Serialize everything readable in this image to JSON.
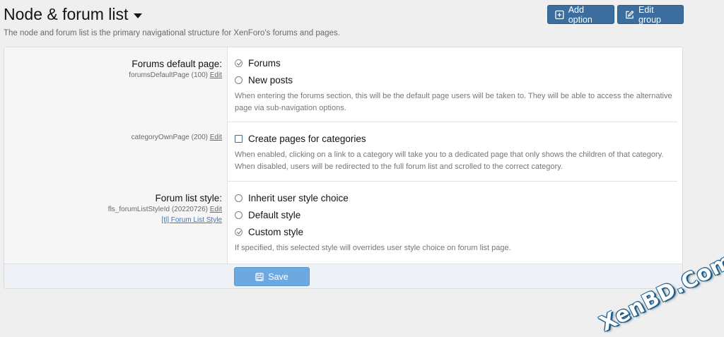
{
  "header": {
    "title": "Node & forum list",
    "description": "The node and forum list is the primary navigational structure for XenForo's forums and pages.",
    "add_option_label": "Add option",
    "edit_group_label": "Edit group"
  },
  "options": {
    "forums_default_page": {
      "label": "Forums default page:",
      "id_text": "forumsDefaultPage (100)",
      "edit_label": "Edit",
      "choices": [
        {
          "label": "Forums",
          "checked": true
        },
        {
          "label": "New posts",
          "checked": false
        }
      ],
      "hint": "When entering the forums section, this will be the default page users will be taken to. They will be able to access the alternative page via sub-navigation options."
    },
    "category_own_page": {
      "id_text": "categoryOwnPage (200)",
      "edit_label": "Edit",
      "checkbox_label": "Create pages for categories",
      "checked": false,
      "hint": "When enabled, clicking on a link to a category will take you to a dedicated page that only shows the children of that category. When disabled, users will be redirected to the full forum list and scrolled to the correct category."
    },
    "forum_list_style": {
      "label": "Forum list style:",
      "id_text": "fls_forumListStyleId (20220726)",
      "edit_label": "Edit",
      "addon_link": "[tl] Forum List Style",
      "choices": [
        {
          "label": "Inherit user style choice",
          "checked": false
        },
        {
          "label": "Default style",
          "checked": false
        },
        {
          "label": "Custom style",
          "checked": true
        }
      ],
      "hint": "If specified, this selected style will overrides user style choice on forum list page."
    }
  },
  "footer": {
    "save_label": "Save"
  },
  "watermark": "XenBD.Com",
  "colors": {
    "primary_button": "#3b6e9e",
    "save_button": "#6ea8e0",
    "link": "#3b75c4"
  }
}
